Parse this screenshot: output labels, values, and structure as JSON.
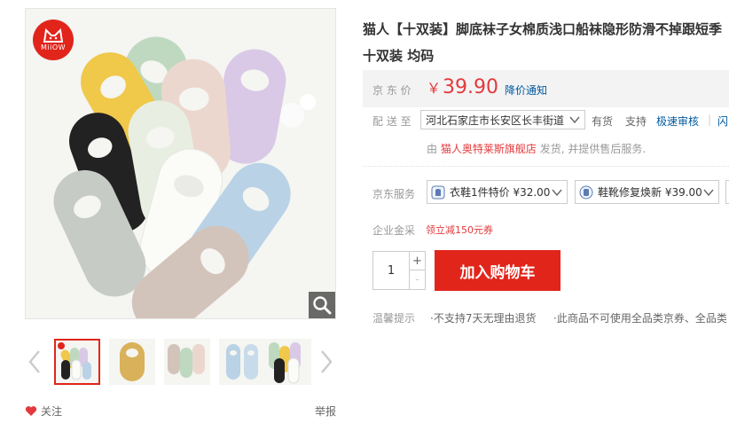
{
  "product": {
    "title": "猫人【十双装】脚底袜子女棉质浅口船袜隐形防滑不掉跟短季 十双装 均码"
  },
  "brand_logo": {
    "text": "MiiOW"
  },
  "gallery": {
    "thumb_count": 5,
    "active_index": 0
  },
  "actions": {
    "follow": "关注",
    "report": "举报"
  },
  "price": {
    "label": "京 东 价",
    "currency": "￥",
    "value": "39.90",
    "notice": "降价通知",
    "color": "#e4393c"
  },
  "delivery": {
    "label": "配 送 至",
    "address": "河北石家庄市长安区长丰街道",
    "stock": "有货",
    "support": "支持",
    "express": "极速审核",
    "separator": "|",
    "flash": "闪"
  },
  "seller": {
    "prefix": "由",
    "shop": "猫人奥特莱斯旗舰店",
    "suffix": "发货, 并提供售后服务."
  },
  "services": {
    "label": "京东服务",
    "items": [
      {
        "text": "衣鞋1件特价 ¥32.00",
        "icon": "clothing-service-icon"
      },
      {
        "text": "鞋靴修复焕新 ¥39.00",
        "icon": "shoe-repair-icon"
      }
    ]
  },
  "corporate": {
    "label": "企业金采",
    "coupon": "领立减150元券"
  },
  "quantity": {
    "value": "1",
    "plus": "+",
    "minus": "-"
  },
  "cart": {
    "label": "加入购物车",
    "color": "#e1251b"
  },
  "tips": {
    "label": "温馨提示",
    "items": [
      "·不支持7天无理由退货",
      "·此商品不可使用全品类京券、全品类"
    ]
  }
}
